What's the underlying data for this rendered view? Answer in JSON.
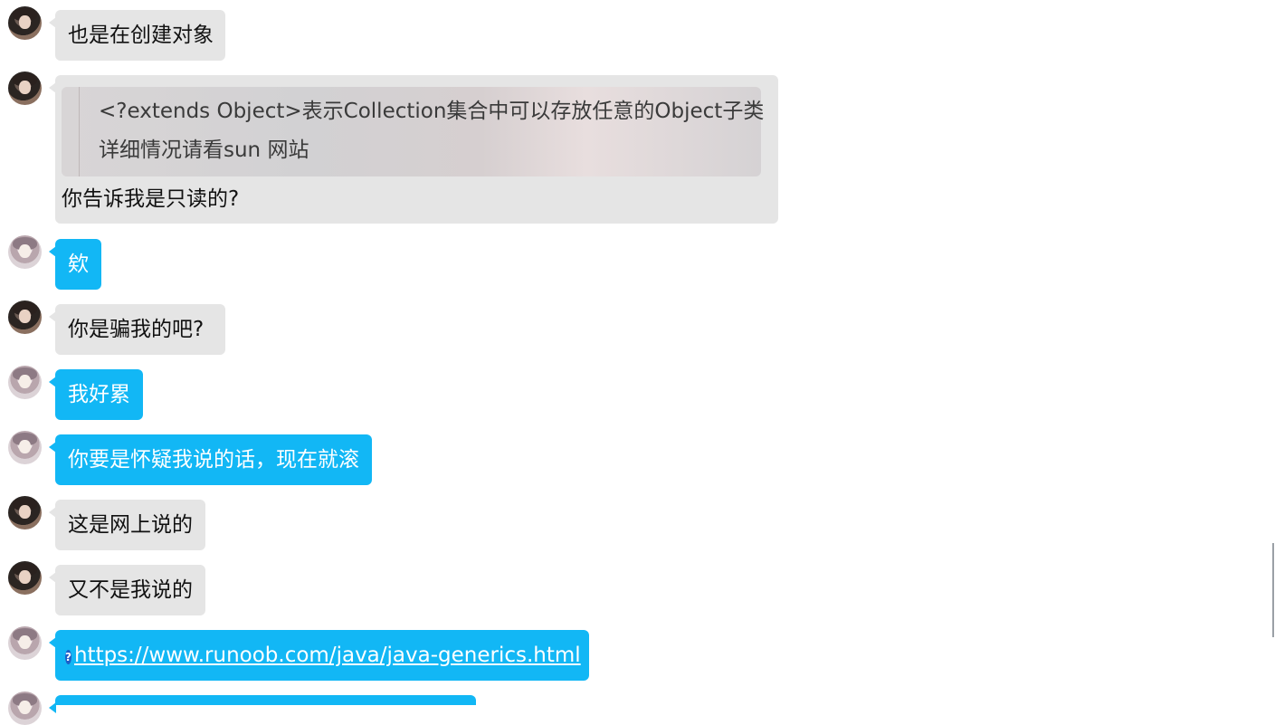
{
  "messages": [
    {
      "id": "m1",
      "sender": "other",
      "text": "也是在创建对象"
    },
    {
      "id": "m2",
      "sender": "other",
      "quote": [
        "<?extends Object>表示Collection集合中可以存放任意的Object子类",
        "详细情况请看sun 网站"
      ],
      "text": "你告诉我是只读的?"
    },
    {
      "id": "m3",
      "sender": "me",
      "text": "欸"
    },
    {
      "id": "m4",
      "sender": "other",
      "text": "你是骗我的吧?"
    },
    {
      "id": "m5",
      "sender": "me",
      "text": "我好累"
    },
    {
      "id": "m6",
      "sender": "me",
      "text": "你要是怀疑我说的话，现在就滚"
    },
    {
      "id": "m7",
      "sender": "other",
      "text": "这是网上说的"
    },
    {
      "id": "m8",
      "sender": "other",
      "text": "又不是我说的"
    },
    {
      "id": "m9",
      "sender": "me",
      "link": "https://www.runoob.com/java/java-generics.html",
      "icon": "question-icon"
    }
  ],
  "colors": {
    "other_bubble": "#e5e5e5",
    "me_bubble": "#12b7f5"
  }
}
